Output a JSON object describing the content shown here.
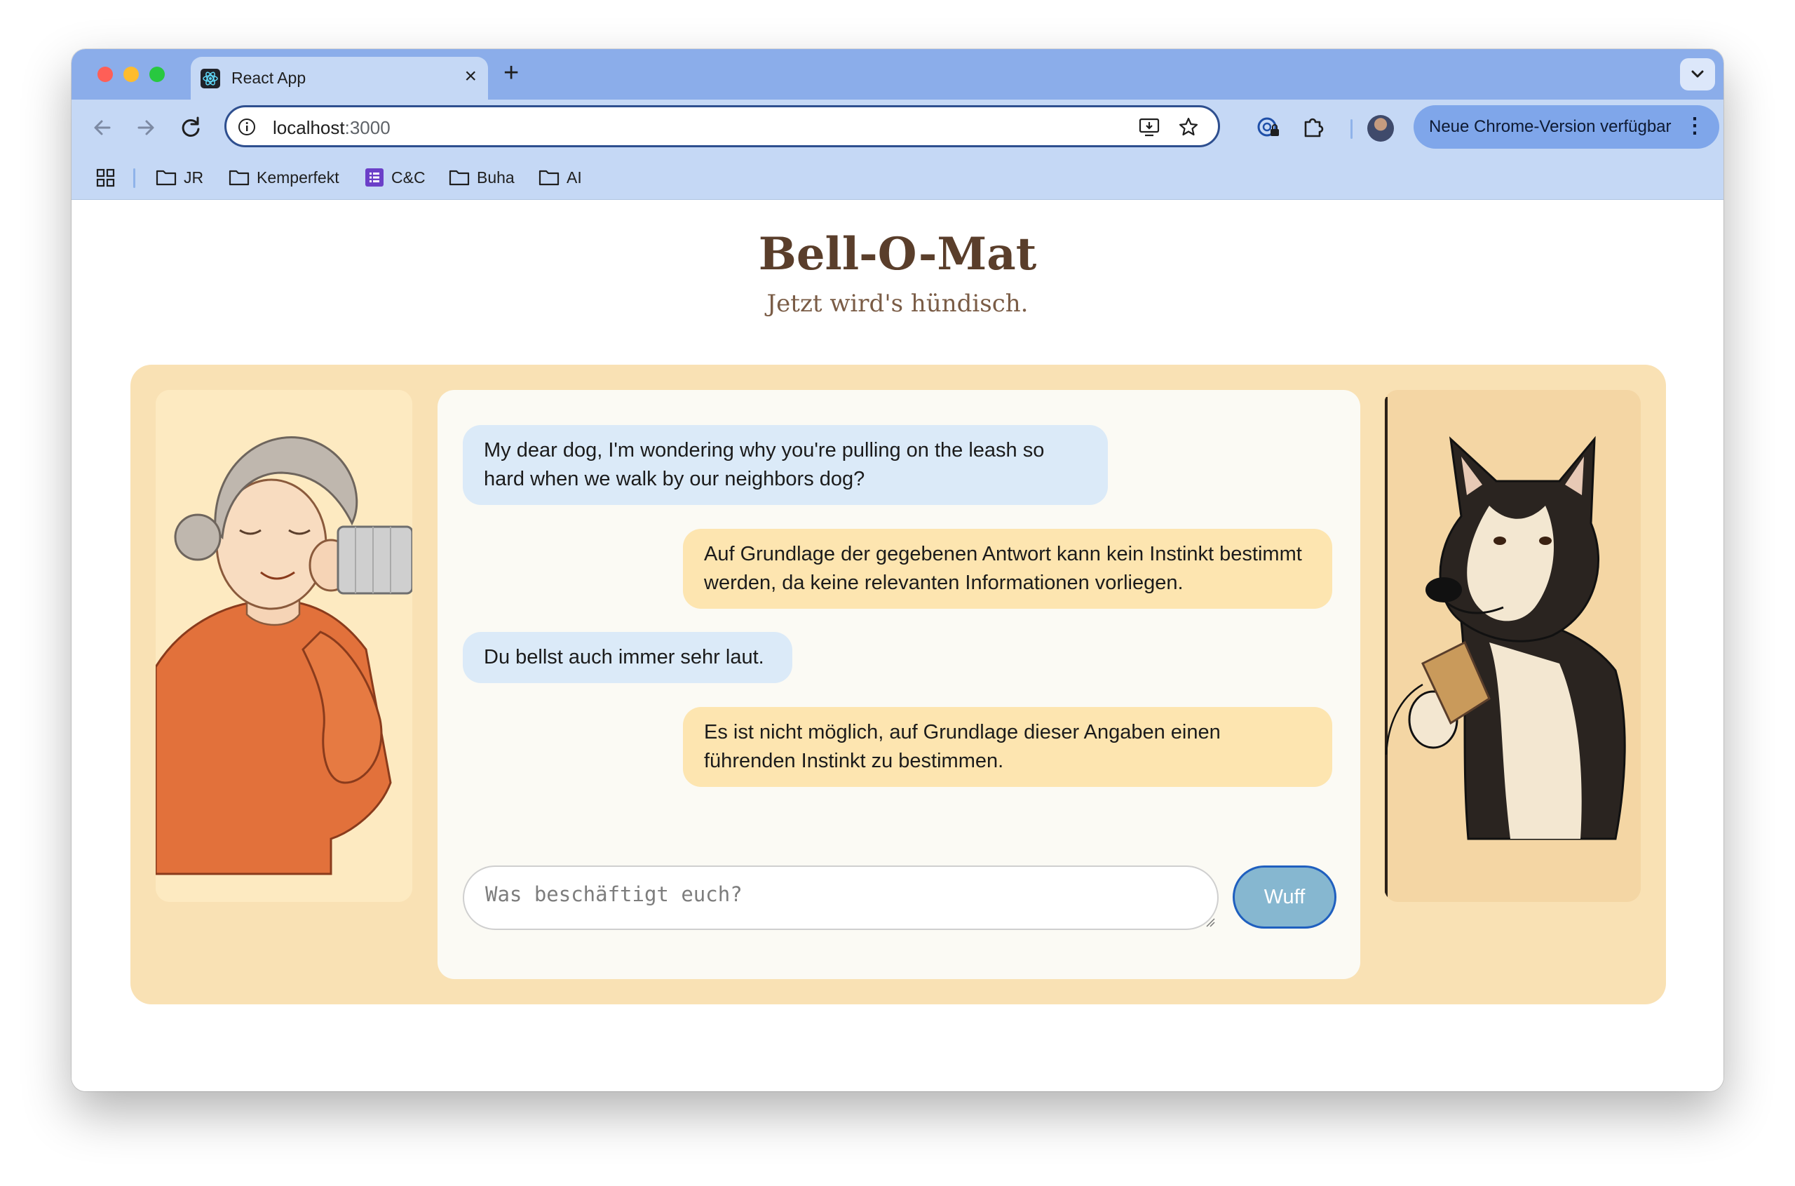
{
  "browser": {
    "tab": {
      "title": "React App",
      "favicon": "react-atom-icon",
      "close": "×"
    },
    "new_tab": "+",
    "url_host": "localhost",
    "url_port": ":3000",
    "update_button": "Neue Chrome-Version verfügbar",
    "menu_glyph": "⋮",
    "bookmarks": [
      {
        "label": "JR",
        "icon": "folder-icon"
      },
      {
        "label": "Kemperfekt",
        "icon": "folder-icon"
      },
      {
        "label": "C&C",
        "icon": "form-icon"
      },
      {
        "label": "Buha",
        "icon": "folder-icon"
      },
      {
        "label": "AI",
        "icon": "folder-icon"
      }
    ]
  },
  "app": {
    "title": "Bell-O-Mat",
    "subtitle": "Jetzt wird's hündisch."
  },
  "chat": {
    "messages": [
      {
        "role": "user",
        "text": "My dear dog, I'm wondering why you're pulling on the leash so hard when we walk by our neighbors dog?"
      },
      {
        "role": "dog",
        "text": "Auf Grundlage der gegebenen Antwort kann kein Instinkt bestimmt werden, da keine relevanten Informationen vorliegen."
      },
      {
        "role": "user",
        "text": "Du bellst auch immer sehr laut."
      },
      {
        "role": "dog",
        "text": "Es ist nicht möglich, auf Grundlage dieser Angaben einen führenden Instinkt zu bestimmen."
      }
    ],
    "input_placeholder": "Was beschäftigt euch?",
    "input_value": "",
    "send_label": "Wuff"
  },
  "colors": {
    "tab_strip": "#8badea",
    "toolbar": "#c5d8f5",
    "title_brown": "#5a3e2b",
    "stage_bg": "#f9e1b4",
    "user_bubble": "#dbeaf8",
    "dog_bubble": "#fde5b0",
    "send_button": "#86b7d0"
  }
}
